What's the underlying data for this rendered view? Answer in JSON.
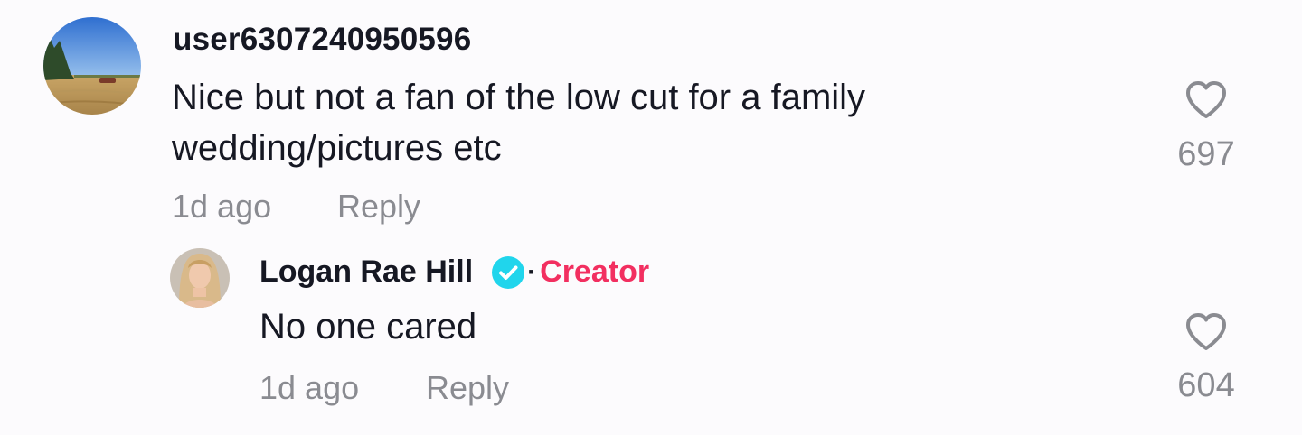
{
  "comment": {
    "username": "user6307240950596",
    "text": "Nice but not a fan of the low cut for a family wedding/pictures etc",
    "time": "1d ago",
    "reply_label": "Reply",
    "likes": "697",
    "like_icon": "heart-outline-icon"
  },
  "reply": {
    "username": "Logan Rae Hill",
    "verified_icon": "verified-badge-icon",
    "separator": "·",
    "creator_label": "Creator",
    "text": "No one cared",
    "time": "1d ago",
    "reply_label": "Reply",
    "likes": "604",
    "like_icon": "heart-outline-icon"
  },
  "colors": {
    "background": "#fcfbfd",
    "text": "#161823",
    "muted": "#8a8b91",
    "creator": "#f22f60",
    "verified": "#20d5ec"
  }
}
